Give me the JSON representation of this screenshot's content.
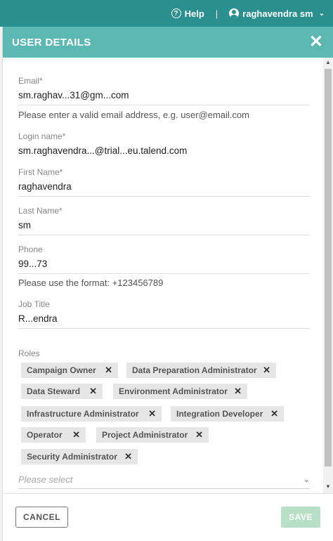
{
  "topbar": {
    "help_label": "Help",
    "help_glyph": "?",
    "separator": "|",
    "user_name": "raghavendra sm",
    "user_chevron": "⌄"
  },
  "panel": {
    "title": "USER DETAILS",
    "close_glyph": "✕"
  },
  "fields": {
    "email": {
      "label": "Email*",
      "value": "sm.raghav...31@gm...com"
    },
    "email_hint": "Please enter a valid email address, e.g. user@email.com",
    "login": {
      "label": "Login name*",
      "value": "sm.raghavendra...@trial...eu.talend.com"
    },
    "first_name": {
      "label": "First Name*",
      "value": "raghavendra"
    },
    "last_name": {
      "label": "Last Name*",
      "value": "sm"
    },
    "phone": {
      "label": "Phone",
      "value": "99...73"
    },
    "phone_hint": "Please use the format: +123456789",
    "job_title": {
      "label": "Job Title",
      "value": "R...endra"
    }
  },
  "roles": {
    "label": "Roles",
    "remove_glyph": "✕",
    "items": [
      "Campaign Owner",
      "Data Preparation Administrator",
      "Data Steward",
      "Environment Administrator",
      "Infrastructure Administrator",
      "Integration Developer",
      "Operator",
      "Project Administrator",
      "Security Administrator"
    ],
    "select_placeholder": "Please select",
    "select_caret": "⌄"
  },
  "footer": {
    "cancel_label": "CANCEL",
    "save_label": "SAVE"
  },
  "colors": {
    "topbar": "#2a8f8f",
    "panel_header": "#5cb8b2",
    "save_disabled": "#b8e0c6",
    "chip_bg": "#e6e6e6"
  }
}
